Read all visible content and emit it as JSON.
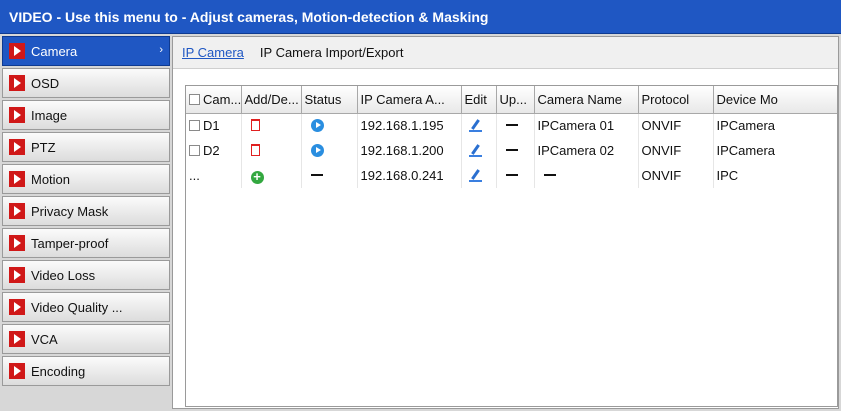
{
  "window": {
    "title": "VIDEO - Use this menu to - Adjust cameras, Motion-detection & Masking"
  },
  "sidebar": {
    "items": [
      {
        "label": "Camera",
        "active": true
      },
      {
        "label": "OSD"
      },
      {
        "label": "Image"
      },
      {
        "label": "PTZ"
      },
      {
        "label": "Motion"
      },
      {
        "label": "Privacy Mask"
      },
      {
        "label": "Tamper-proof"
      },
      {
        "label": "Video Loss"
      },
      {
        "label": "Video Quality ..."
      },
      {
        "label": "VCA"
      },
      {
        "label": "Encoding"
      }
    ]
  },
  "tabs": [
    {
      "label": "IP Camera",
      "active": true
    },
    {
      "label": "IP Camera Import/Export"
    }
  ],
  "table": {
    "columns": [
      "Cam...",
      "Add/De...",
      "Status",
      "IP Camera A...",
      "Edit",
      "Up...",
      "Camera Name",
      "Protocol",
      "Device Mo"
    ],
    "rows": [
      {
        "cam": "D1",
        "status_icon": "play-icon",
        "ip": "192.168.1.195",
        "upgrade": "—",
        "name": "IPCamera 01",
        "protocol": "ONVIF",
        "model": "IPCamera"
      },
      {
        "cam": "D2",
        "status_icon": "play-icon",
        "ip": "192.168.1.200",
        "upgrade": "—",
        "name": "IPCamera 02",
        "protocol": "ONVIF",
        "model": "IPCamera"
      },
      {
        "cam": "...",
        "status": "—",
        "ip": "192.168.0.241",
        "upgrade": "—",
        "name": "—",
        "protocol": "ONVIF",
        "model": "IPC"
      }
    ]
  },
  "colors": {
    "accent": "#1f57c3",
    "arrow": "#d01818",
    "delete": "#e02020",
    "add": "#33a840",
    "status": "#2a8ee0"
  }
}
